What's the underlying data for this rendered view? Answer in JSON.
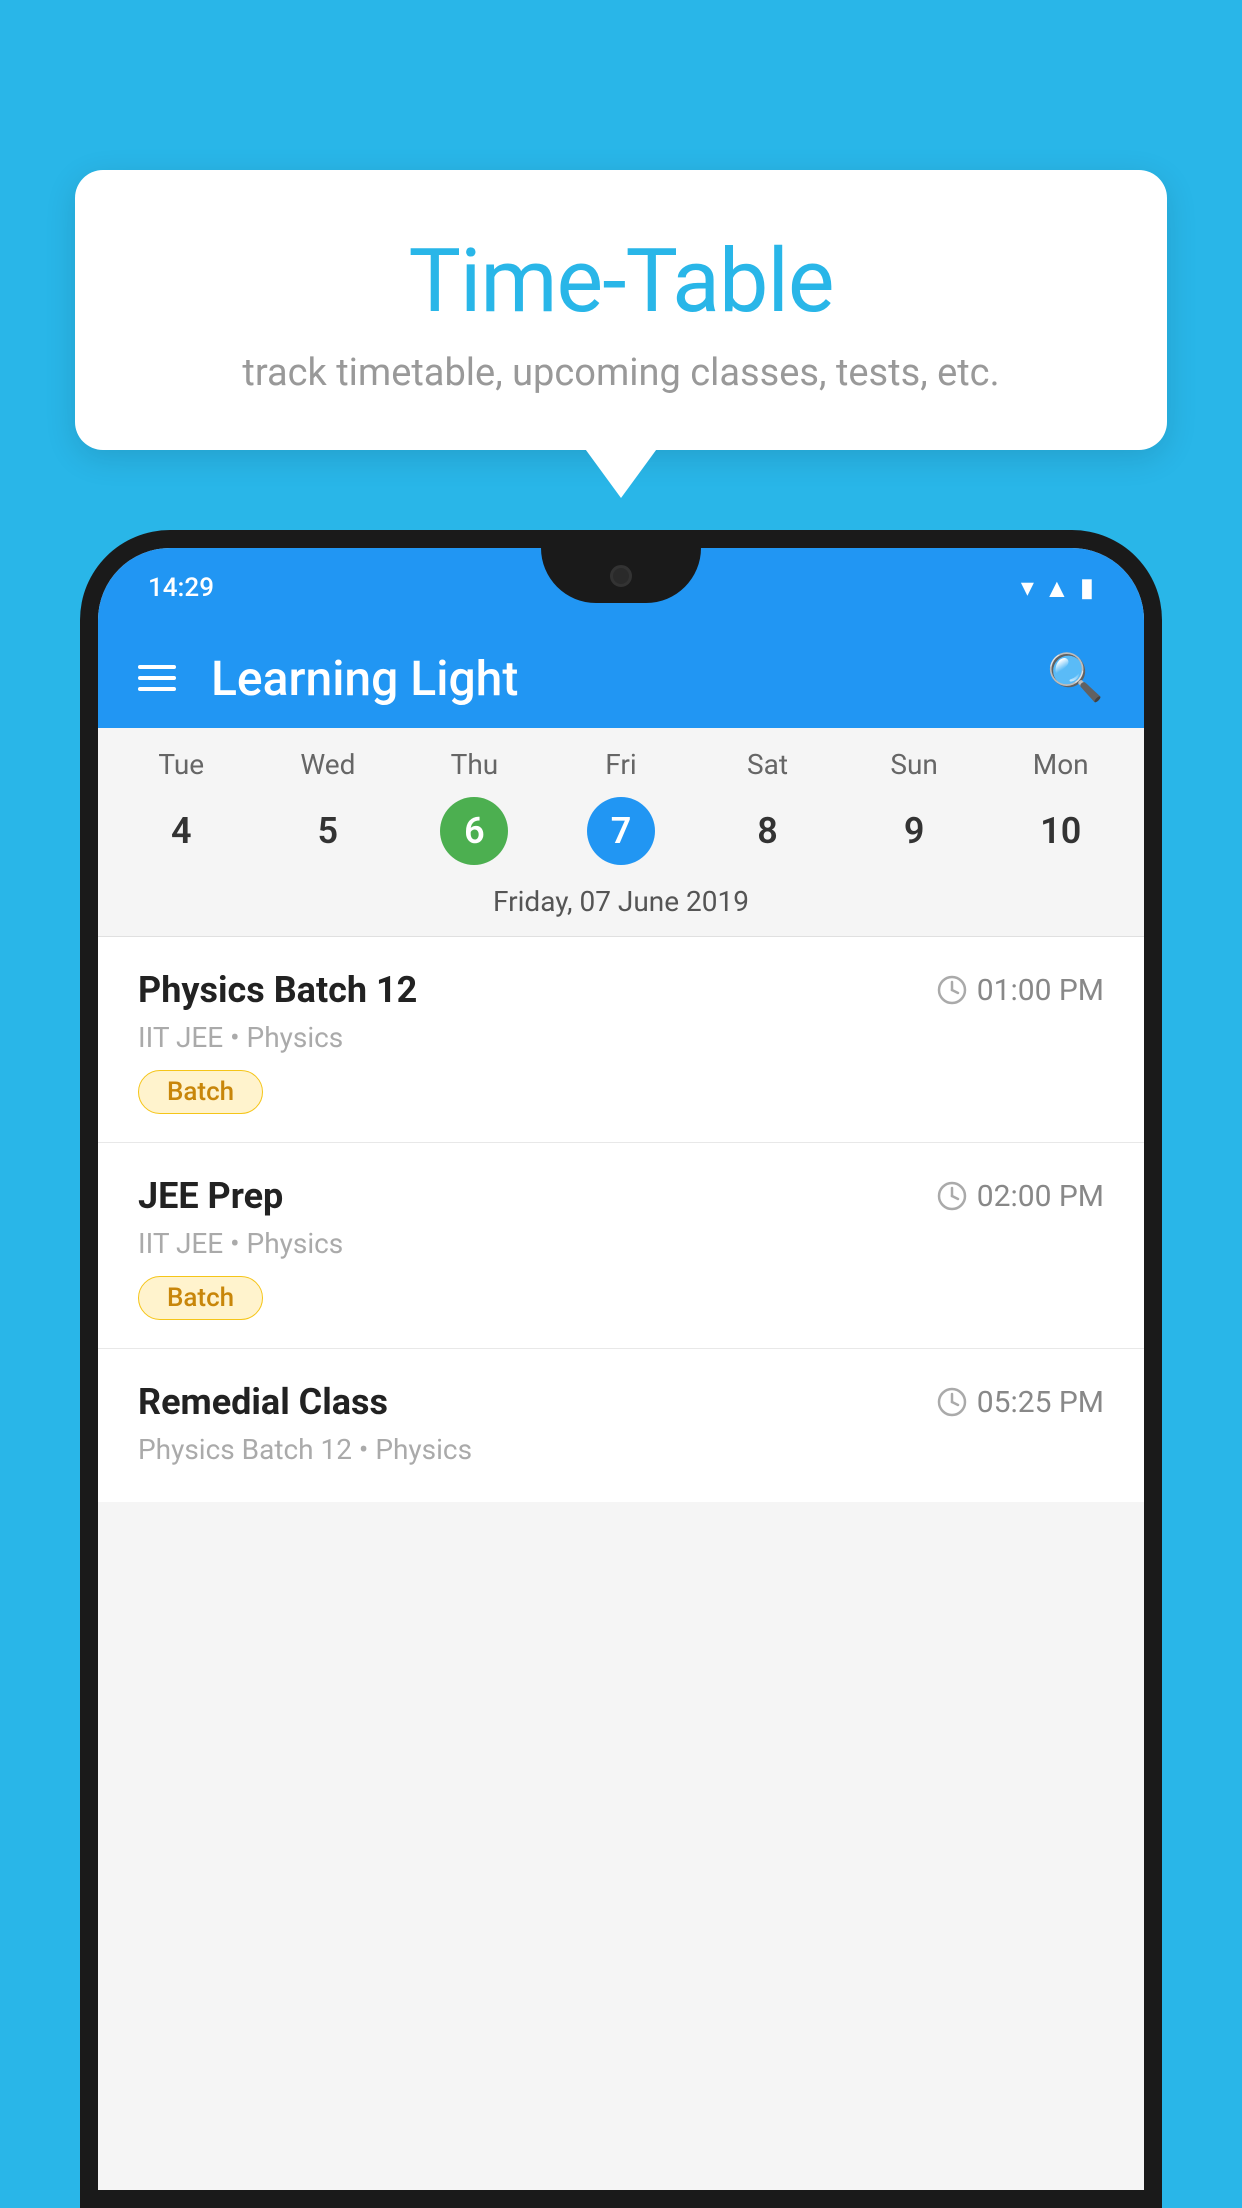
{
  "background": {
    "color": "#29B6E8"
  },
  "tooltip": {
    "title": "Time-Table",
    "subtitle": "track timetable, upcoming classes, tests, etc."
  },
  "phone": {
    "status_bar": {
      "time": "14:29"
    },
    "app_header": {
      "title": "Learning Light"
    },
    "calendar": {
      "day_names": [
        "Tue",
        "Wed",
        "Thu",
        "Fri",
        "Sat",
        "Sun",
        "Mon"
      ],
      "dates": [
        {
          "num": "4",
          "state": "normal"
        },
        {
          "num": "5",
          "state": "normal"
        },
        {
          "num": "6",
          "state": "today"
        },
        {
          "num": "7",
          "state": "selected"
        },
        {
          "num": "8",
          "state": "normal"
        },
        {
          "num": "9",
          "state": "normal"
        },
        {
          "num": "10",
          "state": "normal"
        }
      ],
      "selected_date_label": "Friday, 07 June 2019"
    },
    "schedule_items": [
      {
        "name": "Physics Batch 12",
        "time": "01:00 PM",
        "meta": "IIT JEE • Physics",
        "badge": "Batch"
      },
      {
        "name": "JEE Prep",
        "time": "02:00 PM",
        "meta": "IIT JEE • Physics",
        "badge": "Batch"
      },
      {
        "name": "Remedial Class",
        "time": "05:25 PM",
        "meta": "Physics Batch 12 • Physics",
        "badge": null
      }
    ]
  }
}
